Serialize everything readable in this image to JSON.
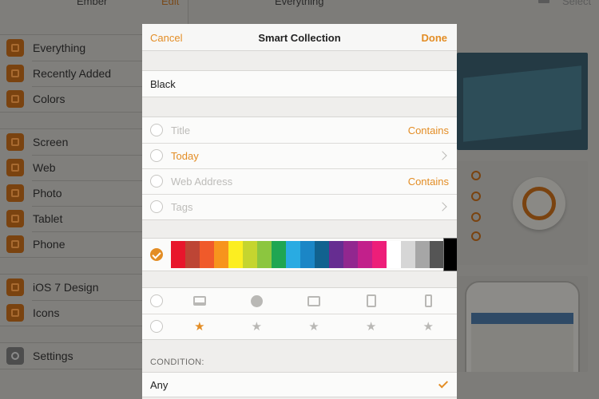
{
  "background": {
    "sidebar_title": "Ember",
    "sidebar_edit": "Edit",
    "main_title": "Everything",
    "select_label": "Select",
    "sidebar_groups": [
      {
        "items": [
          {
            "label": "Everything",
            "icon": "everything-icon"
          },
          {
            "label": "Recently Added",
            "icon": "clock-icon"
          },
          {
            "label": "Colors",
            "icon": "palette-icon"
          }
        ]
      },
      {
        "items": [
          {
            "label": "Screen",
            "icon": "screen-icon"
          },
          {
            "label": "Web",
            "icon": "globe-icon"
          },
          {
            "label": "Photo",
            "icon": "photo-icon"
          },
          {
            "label": "Tablet",
            "icon": "tablet-icon"
          },
          {
            "label": "Phone",
            "icon": "phone-icon"
          }
        ]
      },
      {
        "items": [
          {
            "label": "iOS 7 Design",
            "icon": "smart-collection-icon"
          },
          {
            "label": "Icons",
            "icon": "smart-collection-icon"
          }
        ]
      },
      {
        "items": [
          {
            "label": "Settings",
            "icon": "gear-icon"
          }
        ]
      }
    ]
  },
  "modal": {
    "cancel_label": "Cancel",
    "title": "Smart Collection",
    "done_label": "Done",
    "name_value": "Black",
    "rules": [
      {
        "label": "Title",
        "value": "Contains",
        "active": false,
        "has_chevron": false
      },
      {
        "label": "Today",
        "value": "",
        "active": true,
        "has_chevron": true
      },
      {
        "label": "Web Address",
        "value": "Contains",
        "active": false,
        "has_chevron": false
      },
      {
        "label": "Tags",
        "value": "",
        "active": false,
        "has_chevron": true
      }
    ],
    "color_enabled": true,
    "colors": [
      "#e8162c",
      "#bd4535",
      "#f05a2a",
      "#f7941d",
      "#fcee21",
      "#c5d52f",
      "#8cc63f",
      "#1fa652",
      "#29abe2",
      "#1b86c6",
      "#11628f",
      "#662d91",
      "#92278f",
      "#c2208b",
      "#ed1e79",
      "#ffffff",
      "#d6d6d6",
      "#a6a6a6",
      "#555555",
      "#000000"
    ],
    "selected_color": "#000000",
    "type_icons": [
      "screen-icon",
      "globe-icon",
      "photo-icon",
      "tablet-icon",
      "phone-icon"
    ],
    "rating_stars": 5,
    "rating_value": 1,
    "condition_label": "CONDITION:",
    "condition_value": "Any",
    "accent": "#e38d25"
  }
}
